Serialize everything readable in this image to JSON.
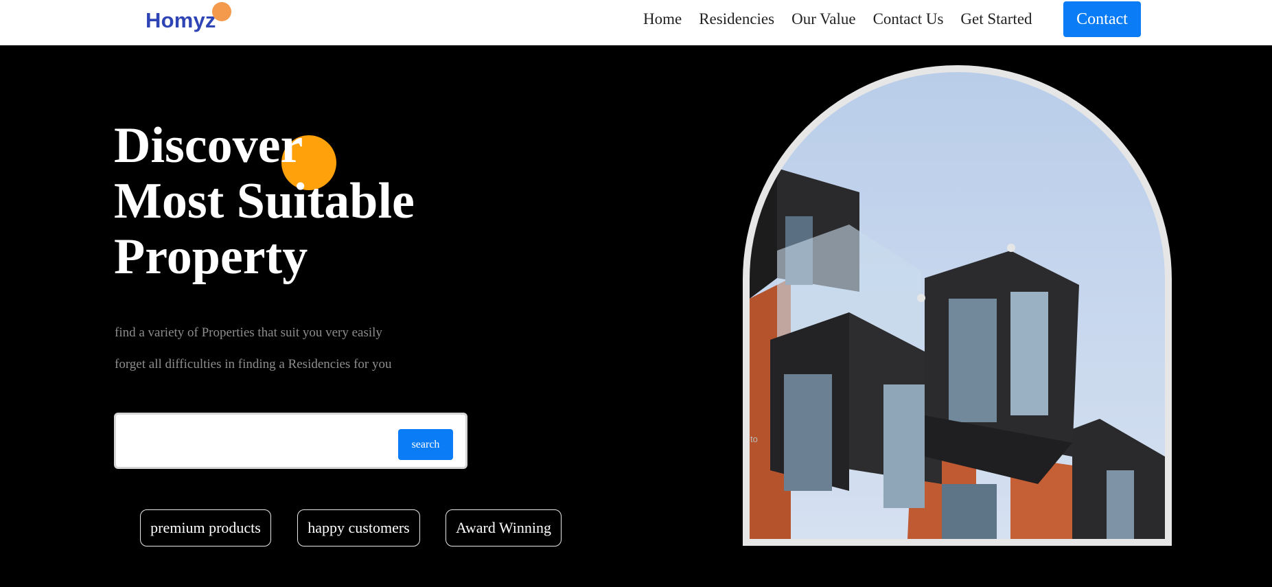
{
  "header": {
    "logo_text": "Homyz",
    "nav": [
      "Home",
      "Residencies",
      "Our Value",
      "Contact Us",
      "Get Started"
    ],
    "contact_button": "Contact"
  },
  "hero": {
    "title_lines": [
      "Discover",
      "Most Suitable",
      "Property"
    ],
    "description_lines": [
      "find a variety of Properties that suit you very easily",
      "forget all difficulties in finding a Residencies for you"
    ],
    "search": {
      "value": "",
      "placeholder": "",
      "button_label": "search"
    },
    "badges": [
      "premium products",
      "happy customers",
      "Award Winning"
    ],
    "image_caption": "to"
  },
  "colors": {
    "accent_blue": "#0a7cf5",
    "logo_blue": "#2f45b6",
    "logo_dot": "#f39a4c",
    "orange_circle": "#ffa10a",
    "background": "#000000"
  },
  "icons": [
    "logo-dot"
  ]
}
